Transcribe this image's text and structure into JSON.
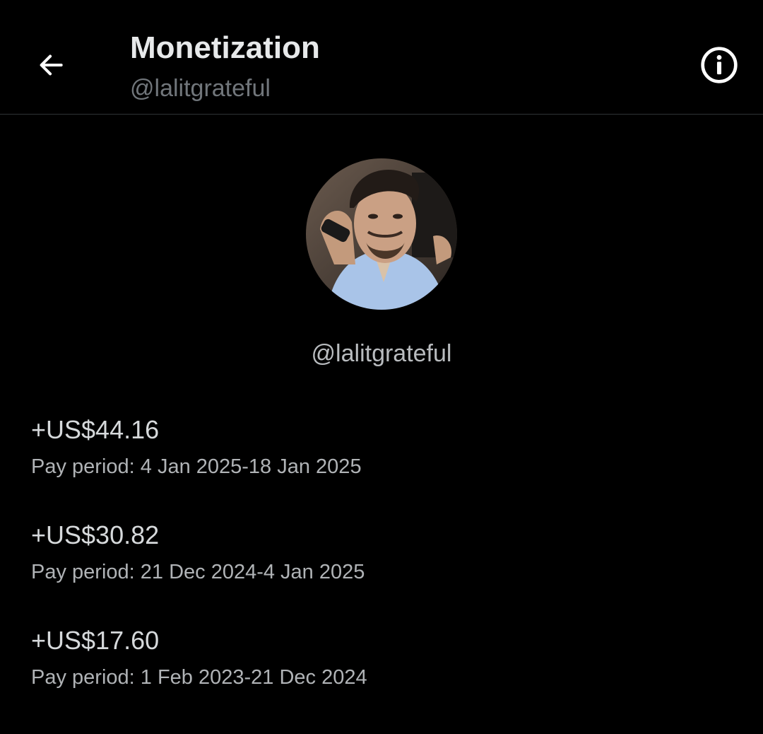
{
  "header": {
    "title": "Monetization",
    "subtitle": "@lalitgrateful",
    "back_icon": "arrow-left-icon",
    "info_icon": "info-circle-icon"
  },
  "profile": {
    "handle": "@lalitgrateful"
  },
  "payouts": [
    {
      "amount": "+US$44.16",
      "period": "Pay period: 4 Jan 2025-18 Jan 2025"
    },
    {
      "amount": "+US$30.82",
      "period": "Pay period: 21 Dec 2024-4 Jan 2025"
    },
    {
      "amount": "+US$17.60",
      "period": "Pay period: 1 Feb 2023-21 Dec 2024"
    }
  ],
  "colors": {
    "background": "#000000",
    "primary_text": "#e7e9ea",
    "secondary_text": "#71767b",
    "divider": "#2f3336"
  }
}
